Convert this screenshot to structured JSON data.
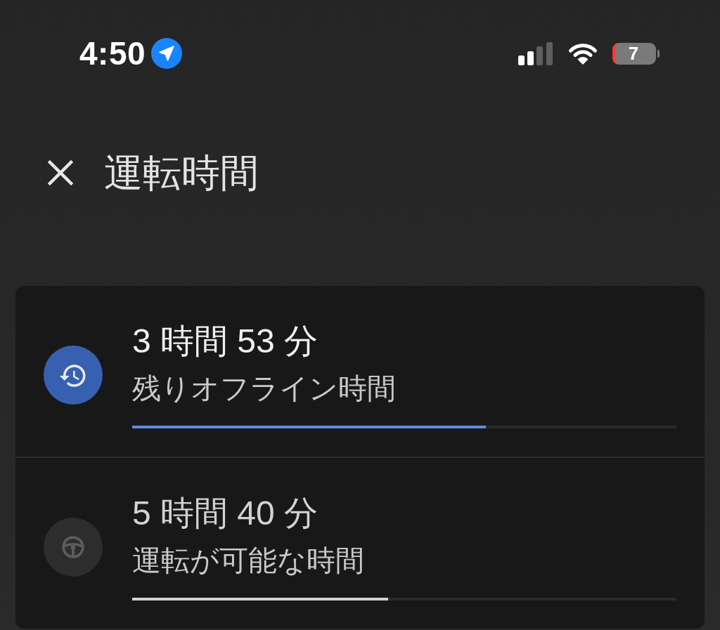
{
  "status_bar": {
    "time": "4:50",
    "battery": "7"
  },
  "header": {
    "title": "運転時間"
  },
  "items": [
    {
      "kind": "offline",
      "active": true,
      "value": "3 時間 53 分",
      "label": "残りオフライン時間",
      "level": 0.65
    },
    {
      "kind": "driving",
      "active": false,
      "value": "5 時間 40 分",
      "label": "運転が可能な時間",
      "level": 0.47
    }
  ]
}
